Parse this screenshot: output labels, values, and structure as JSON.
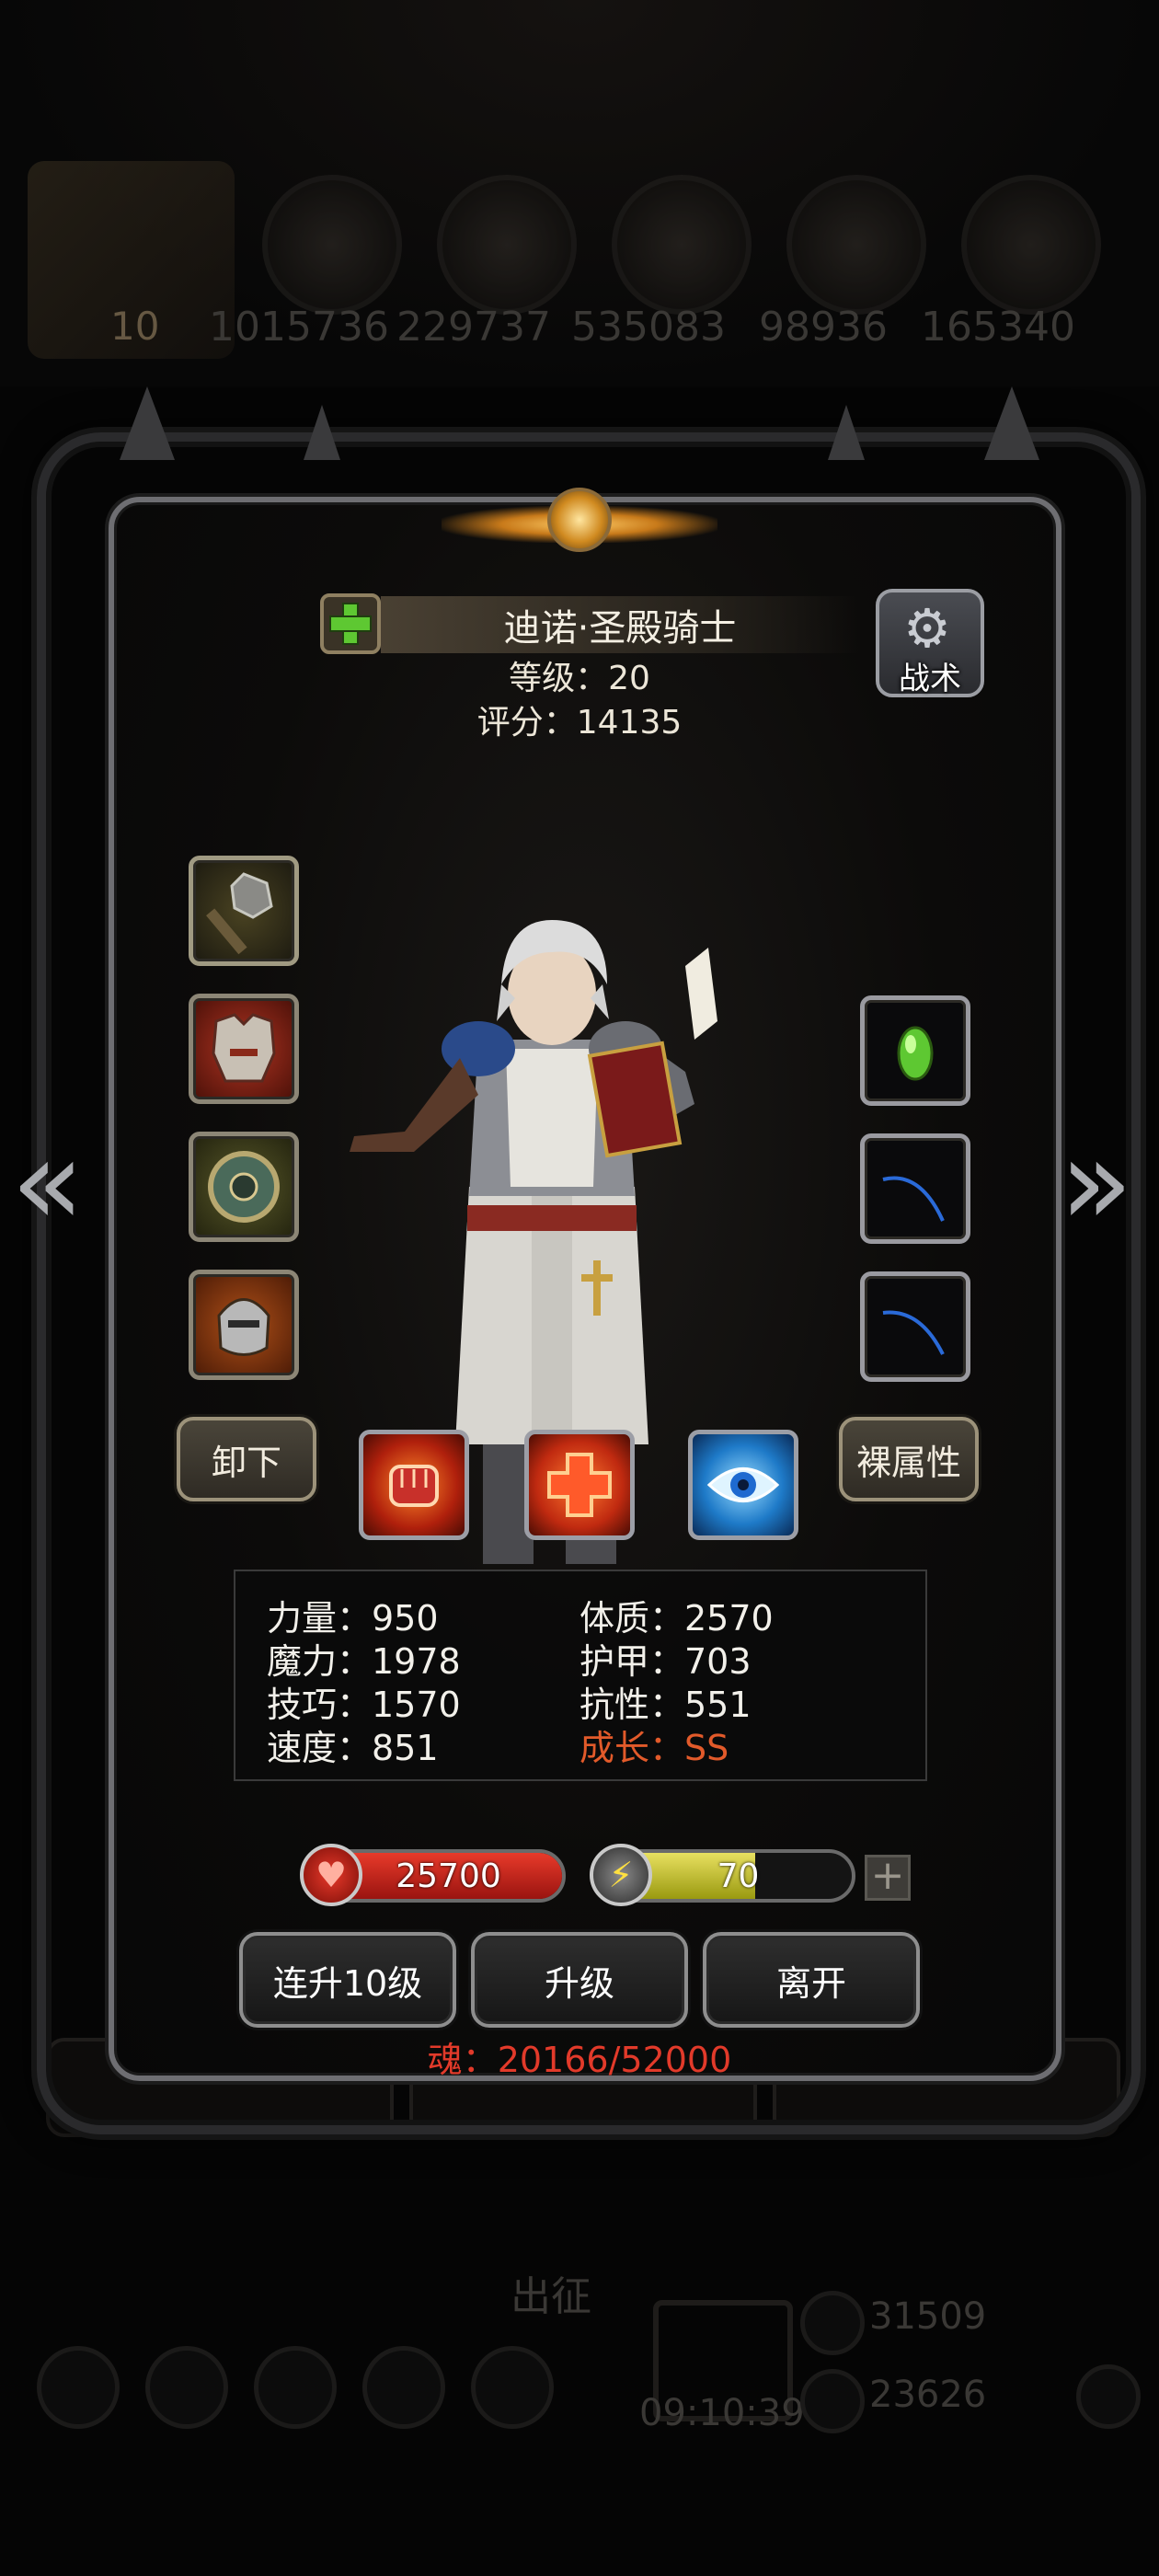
{
  "background": {
    "resources": [
      "1015736",
      "229737",
      "535083",
      "98936",
      "165340"
    ],
    "player_level": "10",
    "expedition_label": "出征",
    "gold": "31509",
    "gems": "23626",
    "timer": "09:10:39"
  },
  "hero": {
    "name": "迪诺·圣殿骑士",
    "level_text": "等级：20",
    "score_text": "评分：14135"
  },
  "tactics_label": "战术",
  "buttons": {
    "unequip": "卸下",
    "bare_attributes": "裸属性",
    "level_up_10": "连升10级",
    "level_up": "升级",
    "leave": "离开"
  },
  "stats": {
    "strength": "力量：950",
    "magic": "魔力：1978",
    "skill": "技巧：1570",
    "speed": "速度：851",
    "constitution": "体质：2570",
    "armor": "护甲：703",
    "resistance": "抗性：551",
    "growth": "成长：SS"
  },
  "hp": {
    "value": "25700",
    "fill": 1.0
  },
  "energy": {
    "value": "70",
    "fill": 0.62
  },
  "soul_text": "魂：20166/52000",
  "colors": {
    "accent_red": "#e23a2a",
    "growth": "#e25a2a",
    "frame": "#6e6e72"
  },
  "icons": {
    "equipment_left": [
      "mace-icon",
      "armor-icon",
      "shield-icon",
      "helmet-icon"
    ],
    "equipment_right": [
      "green-gem-icon",
      "empty-ring-icon",
      "empty-ring-icon"
    ],
    "skills": [
      "fist-icon",
      "heal-cross-icon",
      "eye-icon"
    ]
  }
}
